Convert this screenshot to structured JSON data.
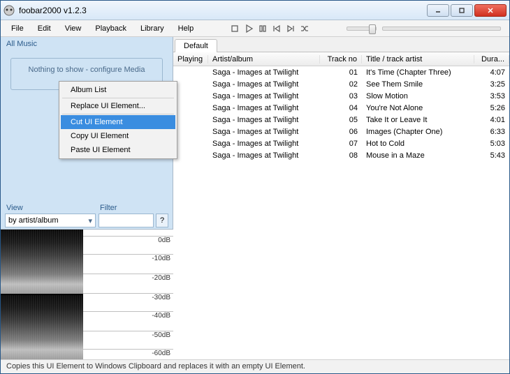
{
  "window": {
    "title": "foobar2000 v1.2.3"
  },
  "menu": {
    "file": "File",
    "edit": "Edit",
    "view": "View",
    "playback": "Playback",
    "library": "Library",
    "help": "Help"
  },
  "left": {
    "title": "All Music",
    "config_msg": "Nothing to show - configure Media",
    "view_label": "View",
    "filter_label": "Filter",
    "view_value": "by artist/album",
    "filter_help": "?"
  },
  "tabs": {
    "default": "Default"
  },
  "columns": {
    "playing": "Playing",
    "artist": "Artist/album",
    "trackno": "Track no",
    "title": "Title / track artist",
    "dur": "Dura..."
  },
  "tracks": [
    {
      "artist": "Saga - Images at Twilight",
      "no": "01",
      "title": "It's Time (Chapter Three)",
      "dur": "4:07"
    },
    {
      "artist": "Saga - Images at Twilight",
      "no": "02",
      "title": "See Them Smile",
      "dur": "3:25"
    },
    {
      "artist": "Saga - Images at Twilight",
      "no": "03",
      "title": "Slow Motion",
      "dur": "3:53"
    },
    {
      "artist": "Saga - Images at Twilight",
      "no": "04",
      "title": "You're Not Alone",
      "dur": "5:26"
    },
    {
      "artist": "Saga - Images at Twilight",
      "no": "05",
      "title": "Take It or Leave It",
      "dur": "4:01"
    },
    {
      "artist": "Saga - Images at Twilight",
      "no": "06",
      "title": "Images (Chapter One)",
      "dur": "6:33"
    },
    {
      "artist": "Saga - Images at Twilight",
      "no": "07",
      "title": "Hot to Cold",
      "dur": "5:03"
    },
    {
      "artist": "Saga - Images at Twilight",
      "no": "08",
      "title": "Mouse in a Maze",
      "dur": "5:43"
    }
  ],
  "context": {
    "album_list": "Album List",
    "replace": "Replace UI Element...",
    "cut": "Cut UI Element",
    "copy": "Copy UI Element",
    "paste": "Paste UI Element"
  },
  "db_ticks": [
    "0dB",
    "-10dB",
    "-20dB",
    "-30dB",
    "-40dB",
    "-50dB",
    "-60dB"
  ],
  "status": "Copies this UI Element to Windows Clipboard and replaces it with an empty UI Element."
}
